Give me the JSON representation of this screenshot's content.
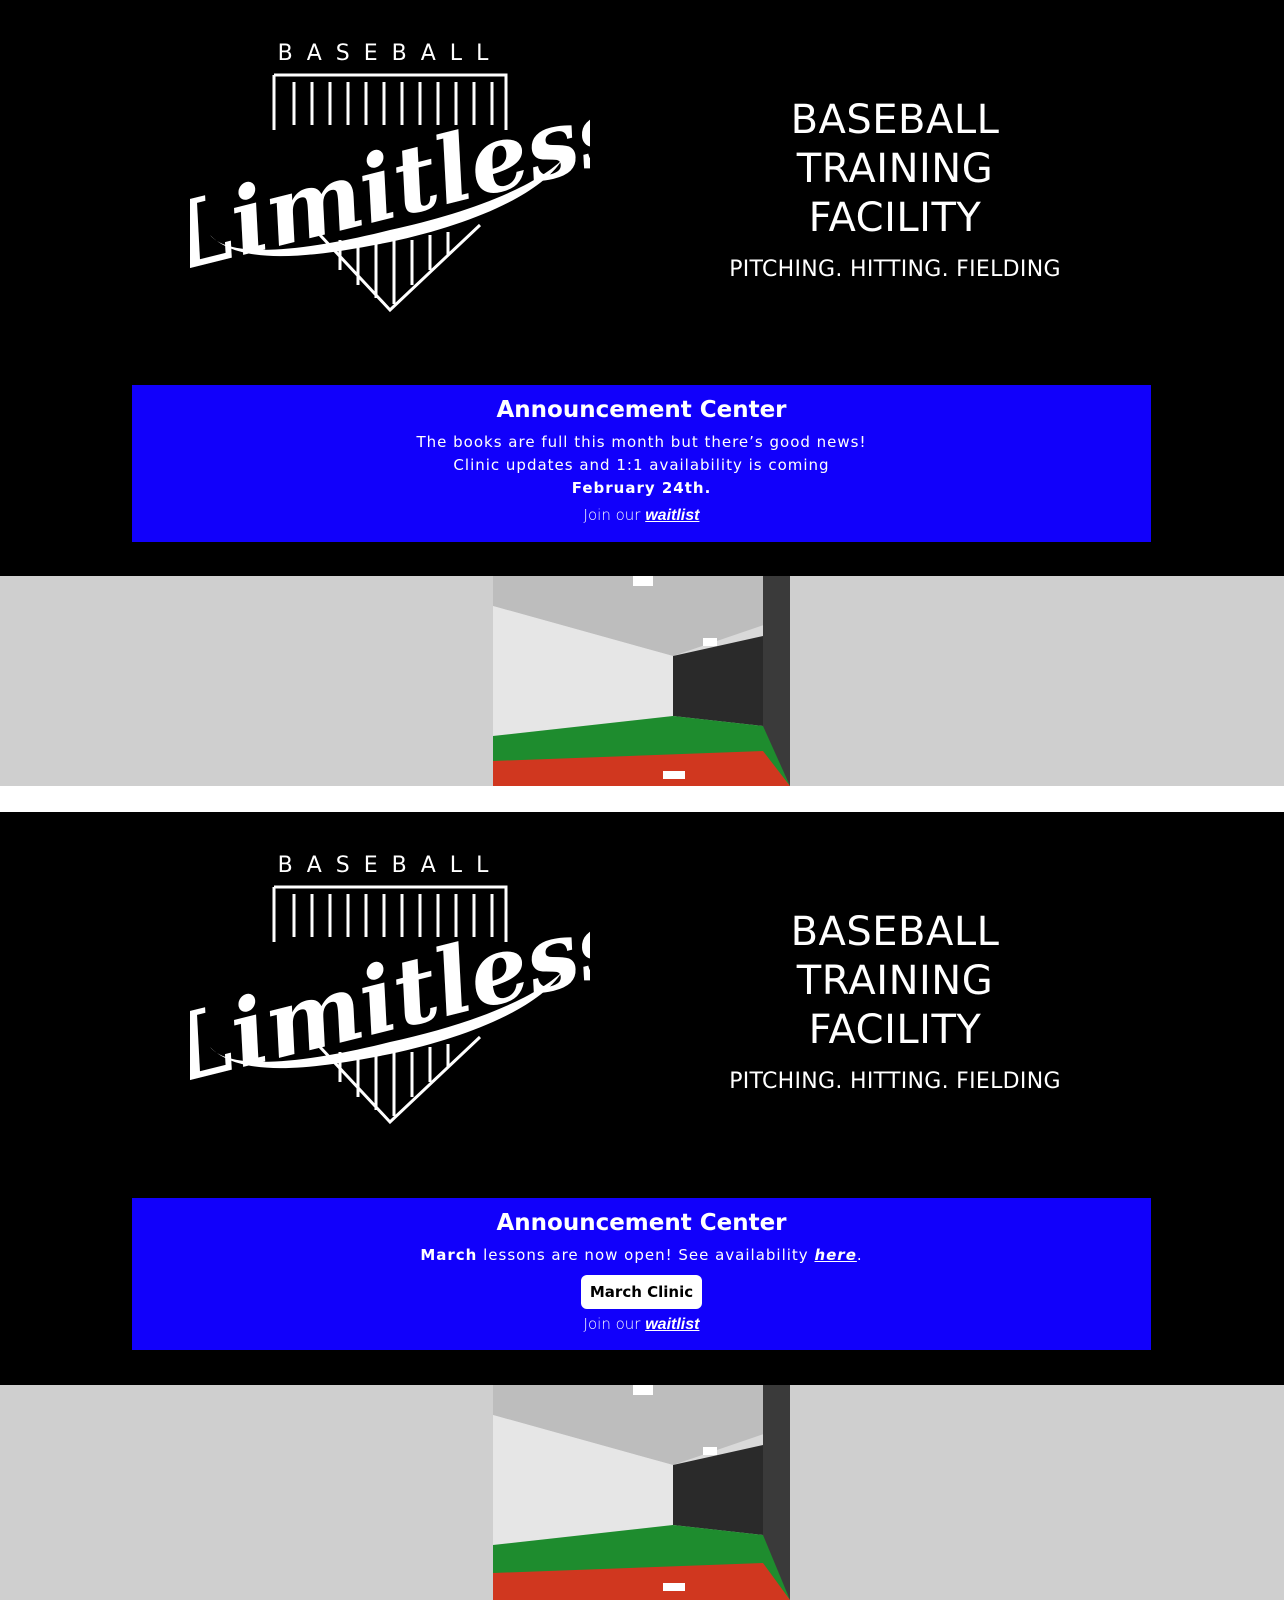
{
  "sections": [
    {
      "logo": {
        "brand_top": "BASEBALL",
        "wordmark": "Limitless"
      },
      "headline": {
        "line1": "BASEBALL",
        "line2": "TRAINING",
        "line3": "FACILITY",
        "tagline": "PITCHING. HITTING. FIELDING"
      },
      "announcement": {
        "title": "Announcement Center",
        "line1": "The books are full this month but there’s good news!",
        "line2": "Clinic updates and 1:1 availability is coming",
        "line3": "February 24th.",
        "join_prefix": "Join our ",
        "join_link": "waitlist"
      }
    },
    {
      "logo": {
        "brand_top": "BASEBALL",
        "wordmark": "Limitless"
      },
      "headline": {
        "line1": "BASEBALL",
        "line2": "TRAINING",
        "line3": "FACILITY",
        "tagline": "PITCHING. HITTING. FIELDING"
      },
      "announcement": {
        "title": "Announcement Center",
        "month": "March",
        "line1_rest": " lessons are now open! See availability ",
        "here_link": "here",
        "period": ".",
        "button": "March Clinic",
        "join_prefix": "Join our ",
        "join_link": "waitlist"
      }
    }
  ],
  "colors": {
    "hero_bg": "#000000",
    "announce_bg": "#1100fb",
    "gallery_bg": "#cfcfcf"
  },
  "icons": {
    "logo": "baseball-limitless-logo",
    "photo": "batting-cage-photo"
  }
}
